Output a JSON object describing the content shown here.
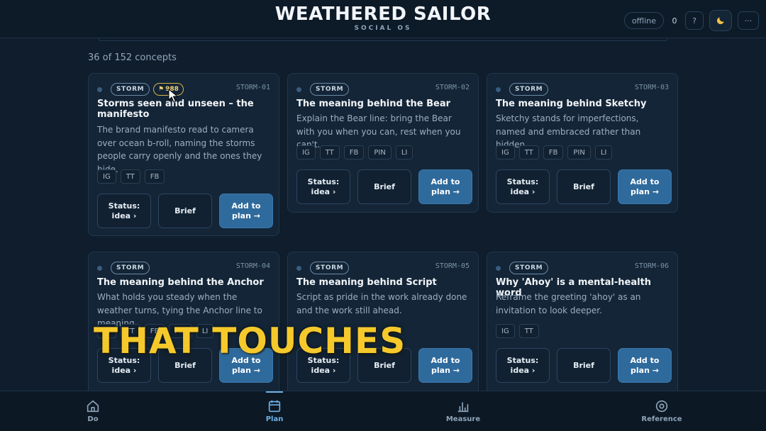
{
  "header": {
    "title": "WEATHERED SAILOR",
    "subtitle": "SOCIAL OS",
    "status": "offline",
    "count": "0",
    "help_label": "?",
    "theme_icon": "moon-icon",
    "more_label": "···"
  },
  "results_count": "36 of 152 concepts",
  "cards": [
    {
      "tag": "STORM",
      "flag": "988",
      "id": "STORM-01",
      "title": "Storms seen and unseen – the manifesto",
      "description": "The brand manifesto read to camera over ocean b-roll, naming the storms people carry openly and the ones they hide.",
      "platforms": [
        "IG",
        "TT",
        "FB"
      ],
      "status_label": "Status:",
      "status_value": "idea ›",
      "brief_label": "Brief",
      "plan_label": "Add to plan →"
    },
    {
      "tag": "STORM",
      "id": "STORM-02",
      "title": "The meaning behind the Bear",
      "description": "Explain the Bear line: bring the Bear with you when you can, rest when you can't.",
      "platforms": [
        "IG",
        "TT",
        "FB",
        "PIN",
        "LI"
      ],
      "status_label": "Status:",
      "status_value": "idea ›",
      "brief_label": "Brief",
      "plan_label": "Add to plan →"
    },
    {
      "tag": "STORM",
      "id": "STORM-03",
      "title": "The meaning behind Sketchy",
      "description": "Sketchy stands for imperfections, named and embraced rather than hidden.",
      "platforms": [
        "IG",
        "TT",
        "FB",
        "PIN",
        "LI"
      ],
      "status_label": "Status:",
      "status_value": "idea ›",
      "brief_label": "Brief",
      "plan_label": "Add to plan →"
    },
    {
      "tag": "STORM",
      "id": "STORM-04",
      "title": "The meaning behind the Anchor",
      "description": "What holds you steady when the weather turns, tying the Anchor line to meaning.",
      "platforms": [
        "IG",
        "TT",
        "FB",
        "PIN",
        "LI"
      ],
      "status_label": "Status:",
      "status_value": "idea ›",
      "brief_label": "Brief",
      "plan_label": "Add to plan →"
    },
    {
      "tag": "STORM",
      "id": "STORM-05",
      "title": "The meaning behind Script",
      "description": "Script as pride in the work already done and the work still ahead.",
      "platforms": [],
      "status_label": "Status:",
      "status_value": "idea ›",
      "brief_label": "Brief",
      "plan_label": "Add to plan →"
    },
    {
      "tag": "STORM",
      "id": "STORM-06",
      "title": "Why 'Ahoy' is a mental-health word",
      "description": "Reframe the greeting 'ahoy' as an invitation to look deeper.",
      "platforms": [
        "IG",
        "TT"
      ],
      "status_label": "Status:",
      "status_value": "idea ›",
      "brief_label": "Brief",
      "plan_label": "Add to plan →"
    }
  ],
  "caption": "THAT TOUCHES",
  "nav": [
    {
      "label": "Do",
      "icon": "home-icon",
      "active": false
    },
    {
      "label": "Plan",
      "icon": "calendar-icon",
      "active": true
    },
    {
      "label": "Measure",
      "icon": "bar-chart-icon",
      "active": false
    },
    {
      "label": "Reference",
      "icon": "target-icon",
      "active": false
    }
  ],
  "colors": {
    "background": "#0f1d2c",
    "card": "#132536",
    "primary_button": "#2f6a9c",
    "caption": "#f5c92c",
    "active_nav": "#6fb1e6"
  }
}
